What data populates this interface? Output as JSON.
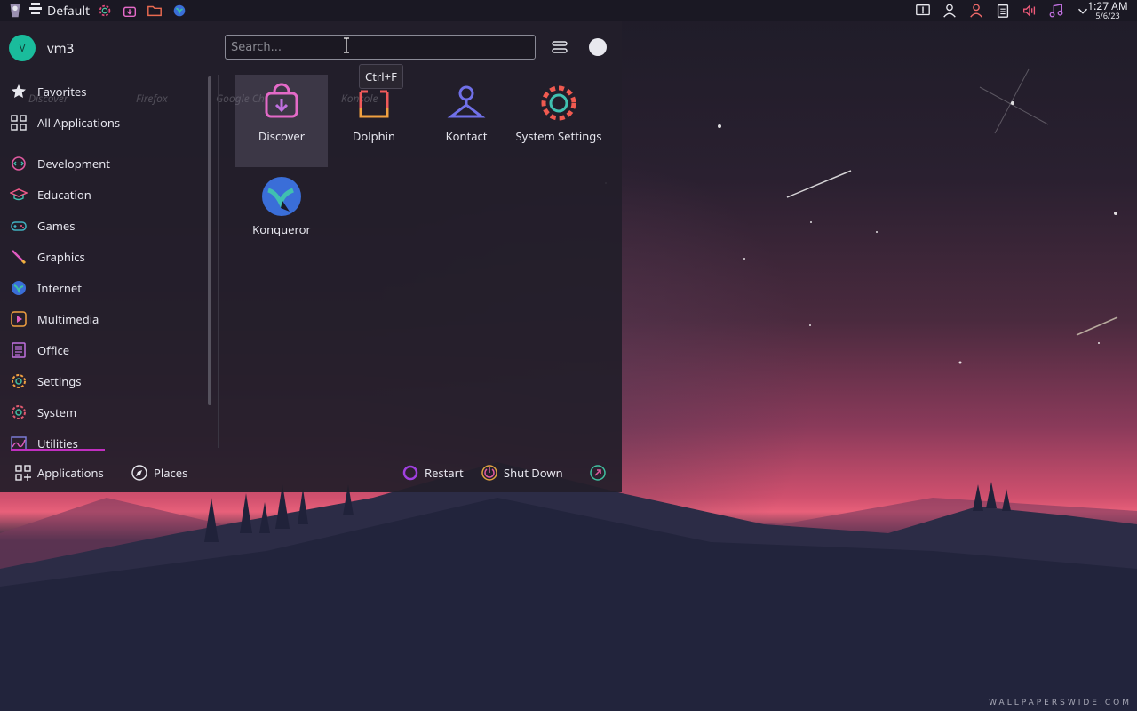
{
  "panel": {
    "activity_label": "Default",
    "icons": [
      "kde-logo-icon",
      "activity-switcher-icon",
      "system-settings-icon",
      "discover-icon",
      "dolphin-folder-icon",
      "konqueror-globe-icon"
    ],
    "tray_icons": [
      "notification-alert-icon",
      "user-switcher-icon",
      "user-account-icon",
      "clipboard-icon",
      "volume-muted-icon",
      "media-player-icon",
      "tray-expand-chevron-icon"
    ],
    "time": "1:27 AM",
    "date": "5/6/23"
  },
  "launcher": {
    "user": {
      "initial": "V",
      "name": "vm3"
    },
    "search": {
      "placeholder": "Search...",
      "value": ""
    },
    "tooltip": "Ctrl+F",
    "categories": [
      {
        "label": "Favorites",
        "icon": "star-icon"
      },
      {
        "label": "All Applications",
        "icon": "grid-icon"
      },
      {
        "label": "Development",
        "icon": "development-icon"
      },
      {
        "label": "Education",
        "icon": "education-icon"
      },
      {
        "label": "Games",
        "icon": "gamepad-icon"
      },
      {
        "label": "Graphics",
        "icon": "graphics-brush-icon"
      },
      {
        "label": "Internet",
        "icon": "globe-icon"
      },
      {
        "label": "Multimedia",
        "icon": "multimedia-play-icon"
      },
      {
        "label": "Office",
        "icon": "office-document-icon"
      },
      {
        "label": "Settings",
        "icon": "settings-gear-icon"
      },
      {
        "label": "System",
        "icon": "system-gear-icon"
      },
      {
        "label": "Utilities",
        "icon": "utilities-chart-icon"
      }
    ],
    "apps": [
      {
        "label": "Discover",
        "icon": "discover-icon",
        "selected": true
      },
      {
        "label": "Dolphin",
        "icon": "dolphin-icon",
        "selected": false
      },
      {
        "label": "Kontact",
        "icon": "kontact-icon",
        "selected": false
      },
      {
        "label": "System Settings",
        "icon": "system-settings-icon",
        "selected": false
      },
      {
        "label": "Konqueror",
        "icon": "konqueror-icon",
        "selected": false
      }
    ],
    "ghost_favorites": [
      "Discover",
      "Firefox",
      "Google Ch",
      "Konsole"
    ],
    "bottom": {
      "applications_label": "Applications",
      "places_label": "Places",
      "restart_label": "Restart",
      "shutdown_label": "Shut Down"
    }
  },
  "wallpaper": {
    "watermark": "WALLPAPERSWIDE.COM"
  },
  "colors": {
    "accent": "#c02fc0",
    "avatar": "#1abc9c",
    "panel": "#1a1822",
    "launcher": "#221e2a"
  }
}
